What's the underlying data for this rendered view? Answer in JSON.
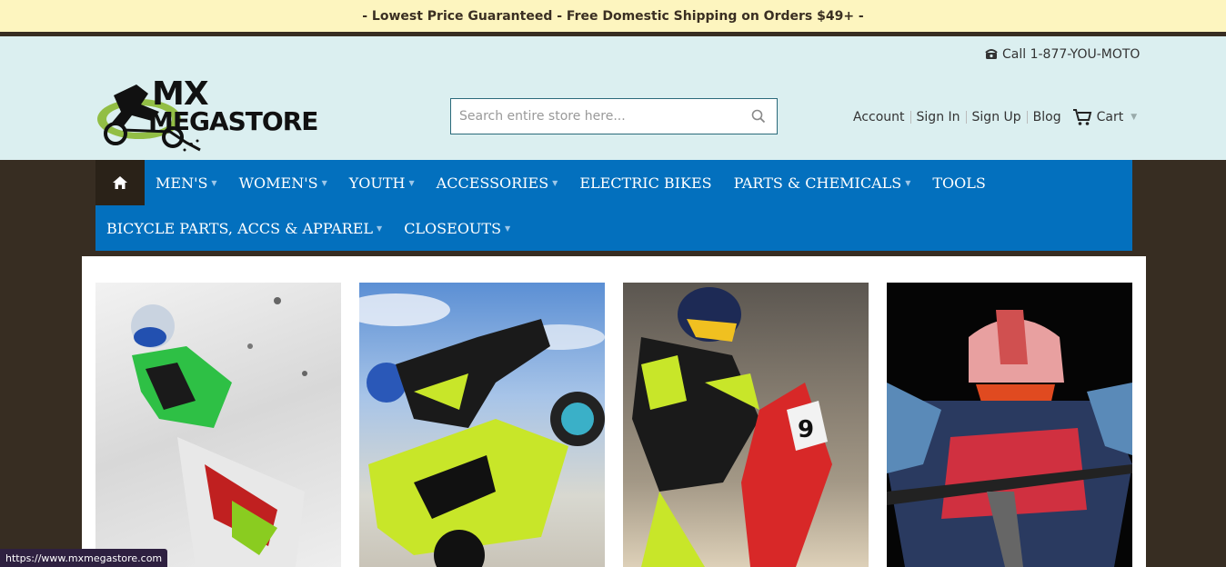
{
  "promo": {
    "text": "- Lowest Price Guaranteed - Free Domestic Shipping on Orders $49+ -"
  },
  "header": {
    "phone": "Call 1-877-YOU-MOTO",
    "logo": {
      "line1": "MX",
      "line2": "MEGASTORE"
    },
    "search": {
      "placeholder": "Search entire store here..."
    },
    "links": [
      "Account",
      "Sign In",
      "Sign Up",
      "Blog"
    ],
    "cart_label": "Cart"
  },
  "nav": {
    "row1": [
      "MEN'S",
      "WOMEN'S",
      "YOUTH",
      "ACCESSORIES",
      "ELECTRIC BIKES",
      "PARTS & CHEMICALS",
      "TOOLS"
    ],
    "row2": [
      "BICYCLE PARTS, ACCS & APPAREL",
      "CLOSEOUTS"
    ]
  },
  "status_url": "https://www.mxmegastore.com",
  "colors": {
    "nav_bg": "#0370be",
    "header_bg": "#dbeff0",
    "promo_bg": "#fdf5bf",
    "page_bg": "#372d22"
  }
}
